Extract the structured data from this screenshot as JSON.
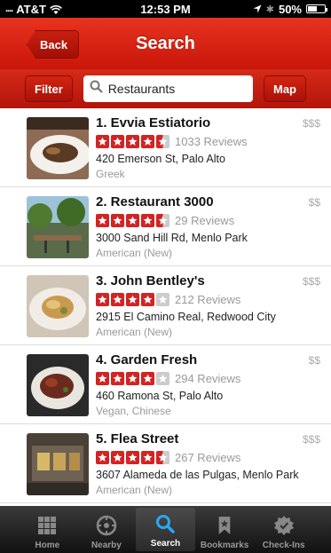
{
  "status_bar": {
    "carrier": "AT&T",
    "signal_dots": "....",
    "time": "12:53 PM",
    "battery": "50%"
  },
  "nav": {
    "title": "Search",
    "back_label": "Back"
  },
  "search": {
    "filter_label": "Filter",
    "query": "Restaurants",
    "map_label": "Map"
  },
  "colors": {
    "brand_red": "#d52a18",
    "star_red": "#d32323",
    "star_grey": "#cccccc"
  },
  "results": [
    {
      "title": "1. Evvia Estiatorio",
      "price": "$$$",
      "rating": 4.5,
      "reviews": "1033 Reviews",
      "address": "420 Emerson St, Palo Alto",
      "category": "Greek",
      "thumb": "plated-food-photo"
    },
    {
      "title": "2. Restaurant 3000",
      "price": "$$",
      "rating": 4.5,
      "reviews": "29 Reviews",
      "address": "3000 Sand Hill Rd, Menlo Park",
      "category": "American (New)",
      "thumb": "patio-trees-photo"
    },
    {
      "title": "3. John Bentley's",
      "price": "$$$",
      "rating": 4,
      "reviews": "212 Reviews",
      "address": "2915 El Camino Real, Redwood City",
      "category": "American (New)",
      "thumb": "plated-food-photo"
    },
    {
      "title": "4. Garden Fresh",
      "price": "$$",
      "rating": 4,
      "reviews": "294 Reviews",
      "address": "460 Ramona St, Palo Alto",
      "category": "Vegan, Chinese",
      "thumb": "dish-photo"
    },
    {
      "title": "5. Flea Street",
      "price": "$$$",
      "rating": 4.5,
      "reviews": "267 Reviews",
      "address": "3607 Alameda de las Pulgas, Menlo Park",
      "category": "American (New)",
      "thumb": "storefront-photo"
    }
  ],
  "tabs": [
    {
      "label": "Home",
      "icon": "grid-icon",
      "active": false
    },
    {
      "label": "Nearby",
      "icon": "compass-icon",
      "active": false
    },
    {
      "label": "Search",
      "icon": "magnifier-icon",
      "active": true
    },
    {
      "label": "Bookmarks",
      "icon": "bookmark-icon",
      "active": false
    },
    {
      "label": "Check-Ins",
      "icon": "badge-icon",
      "active": false
    }
  ]
}
